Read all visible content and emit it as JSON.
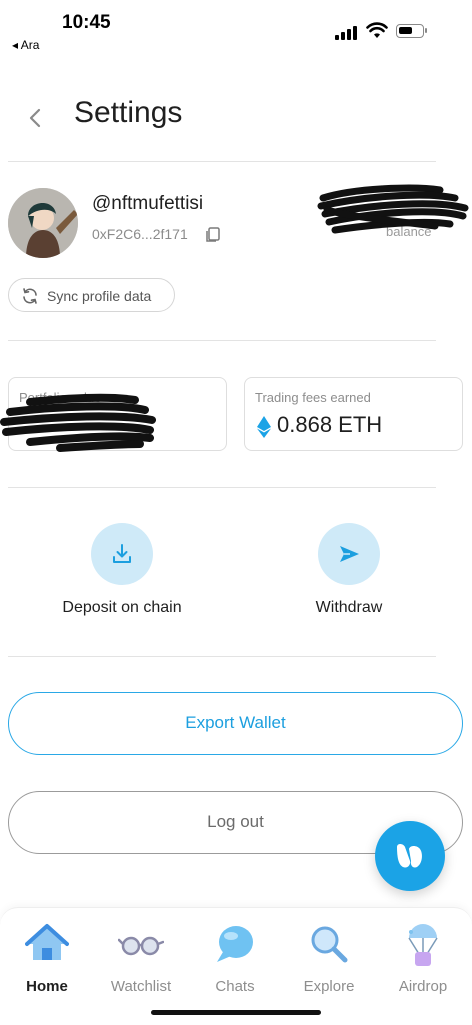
{
  "status_bar": {
    "time": "10:45",
    "back_app": "◂ Ara"
  },
  "header": {
    "title": "Settings",
    "back_icon": "chevron-left-icon"
  },
  "profile": {
    "username": "@nftmufettisi",
    "address": "0xF2C6...2f171",
    "balance_label": "balance",
    "sync_label": "Sync profile data"
  },
  "cards": {
    "portfolio": {
      "label": "Portfolio value"
    },
    "fees": {
      "label": "Trading fees earned",
      "value": "0.868 ETH"
    }
  },
  "actions": {
    "deposit_label": "Deposit on chain",
    "withdraw_label": "Withdraw"
  },
  "buttons": {
    "export_label": "Export Wallet",
    "logout_label": "Log out"
  },
  "nav": {
    "items": [
      {
        "label": "Home",
        "icon": "home-icon",
        "active": true
      },
      {
        "label": "Watchlist",
        "icon": "glasses-icon",
        "active": false
      },
      {
        "label": "Chats",
        "icon": "chat-bubble-icon",
        "active": false
      },
      {
        "label": "Explore",
        "icon": "magnifier-icon",
        "active": false
      },
      {
        "label": "Airdrop",
        "icon": "parachute-icon",
        "active": false
      }
    ]
  },
  "colors": {
    "accent": "#1ba3e6",
    "accent_light": "#cfeaf8",
    "text": "#1f1f1f",
    "muted": "#8d8d8d"
  }
}
